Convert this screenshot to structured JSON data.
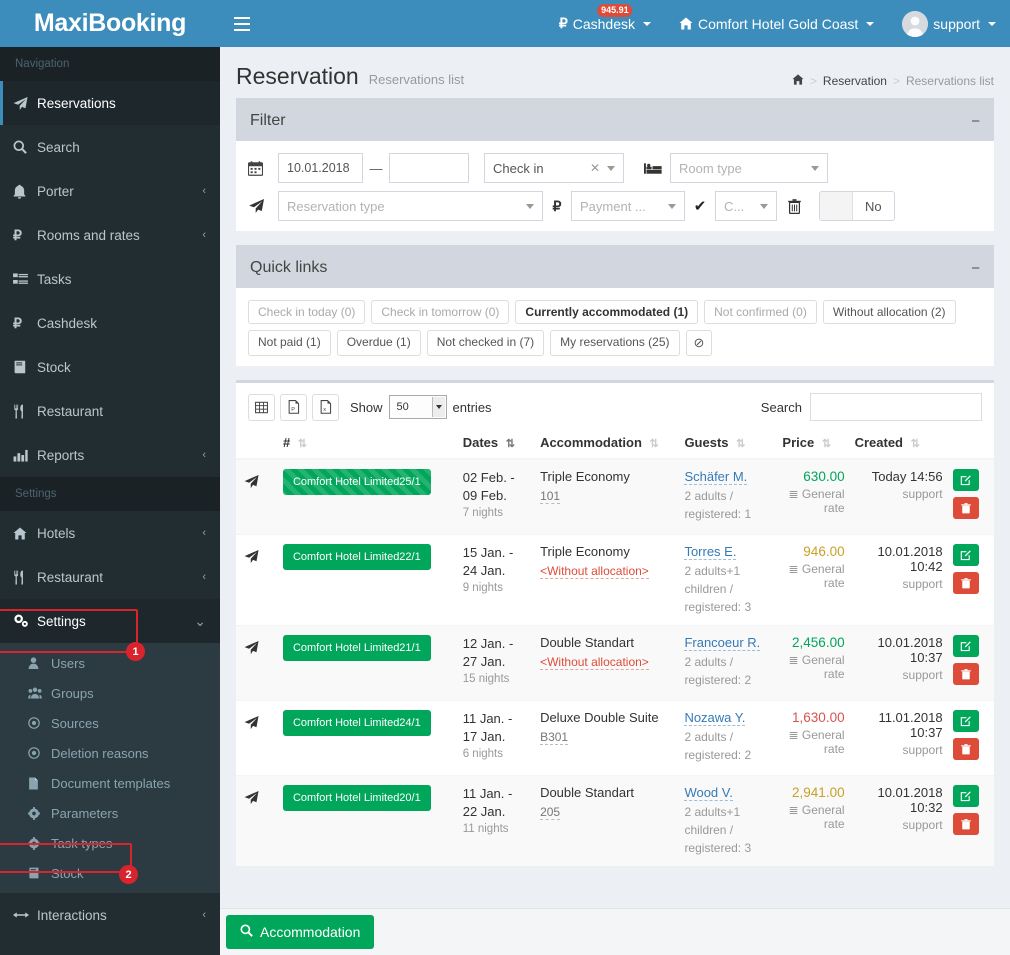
{
  "brand": {
    "name": "MaxiBooking"
  },
  "navbar": {
    "menu_icon": "hamburger-icon",
    "cashdesk": {
      "label": "Cashdesk",
      "badge": "945.91",
      "icon": "ruble-icon"
    },
    "hotel": {
      "label": "Comfort Hotel Gold Coast",
      "icon": "home-icon"
    },
    "user": {
      "label": "support",
      "icon": "avatar-icon"
    }
  },
  "sidebar": {
    "nav_header": "Navigation",
    "settings_header": "Settings",
    "items": [
      {
        "label": "Reservations",
        "icon": "paper-plane-icon",
        "active": true,
        "arrow": ""
      },
      {
        "label": "Search",
        "icon": "search-icon",
        "arrow": ""
      },
      {
        "label": "Porter",
        "icon": "bell-icon",
        "arrow": "‹"
      },
      {
        "label": "Rooms and rates",
        "icon": "ruble-icon",
        "arrow": "‹"
      },
      {
        "label": "Tasks",
        "icon": "tasks-icon",
        "arrow": ""
      },
      {
        "label": "Cashdesk",
        "icon": "ruble-icon",
        "arrow": ""
      },
      {
        "label": "Stock",
        "icon": "book-icon",
        "arrow": ""
      },
      {
        "label": "Restaurant",
        "icon": "cutlery-icon",
        "arrow": ""
      },
      {
        "label": "Reports",
        "icon": "bar-chart-icon",
        "arrow": "‹"
      }
    ],
    "settings_items": [
      {
        "label": "Hotels",
        "icon": "home-icon",
        "arrow": "‹"
      },
      {
        "label": "Restaurant",
        "icon": "cutlery-icon",
        "arrow": "‹"
      },
      {
        "label": "Settings",
        "icon": "gears-icon",
        "arrow": "⌄",
        "highlight": true
      }
    ],
    "settings_sub": [
      {
        "label": "Users",
        "icon": "user-icon"
      },
      {
        "label": "Groups",
        "icon": "users-icon"
      },
      {
        "label": "Sources",
        "icon": "circle-dot-icon"
      },
      {
        "label": "Deletion reasons",
        "icon": "circle-dot-icon"
      },
      {
        "label": "Document templates",
        "icon": "file-icon"
      },
      {
        "label": "Parameters",
        "icon": "gear-icon",
        "highlight": true
      },
      {
        "label": "Task types",
        "icon": "gear-icon"
      },
      {
        "label": "Stock",
        "icon": "book-icon"
      }
    ],
    "interactions": {
      "label": "Interactions",
      "icon": "arrows-h-icon",
      "arrow": "‹"
    },
    "annotations": [
      {
        "num": "1"
      },
      {
        "num": "2"
      }
    ]
  },
  "page": {
    "title": "Reservation",
    "subtitle": "Reservations list",
    "breadcrumb": {
      "home_icon": "home-icon",
      "items": [
        "Reservation",
        "Reservations list"
      ]
    }
  },
  "filter": {
    "title": "Filter",
    "collapse_icon": "−",
    "date_icon": "calendar-icon",
    "date_from": "10.01.2018",
    "date_to": "",
    "dash": "—",
    "date_type": "Check in",
    "bed_icon": "bed-icon",
    "room_type_placeholder": "Room type",
    "plane_icon": "paper-plane-icon",
    "reservation_type_placeholder": "Reservation type",
    "ruble_icon": "ruble-icon",
    "payment_placeholder": "Payment ...",
    "check_icon": "check-icon",
    "confirm_placeholder": "C...",
    "trash_icon": "trash-icon",
    "toggle_label": "No"
  },
  "quick_links": {
    "title": "Quick links",
    "collapse_icon": "−",
    "links": [
      {
        "label": "Check in today (0)",
        "style": "muted"
      },
      {
        "label": "Check in tomorrow (0)",
        "style": "muted"
      },
      {
        "label": "Currently accommodated (1)",
        "style": "strong"
      },
      {
        "label": "Not confirmed (0)",
        "style": "muted"
      },
      {
        "label": "Without allocation (2)",
        "style": "norm"
      },
      {
        "label": "Not paid (1)",
        "style": "norm"
      },
      {
        "label": "Overdue (1)",
        "style": "norm"
      },
      {
        "label": "Not checked in (7)",
        "style": "norm"
      },
      {
        "label": "My reservations (25)",
        "style": "norm"
      }
    ],
    "clear_icon": "⊘"
  },
  "table_toolbar": {
    "buttons": [
      {
        "icon": "table-icon",
        "name": "copy-columns-button"
      },
      {
        "icon": "pdf-icon",
        "name": "export-pdf-button"
      },
      {
        "icon": "excel-icon",
        "name": "export-excel-button"
      }
    ],
    "show_label": "Show",
    "entries_value": "50",
    "entries_label": "entries",
    "search_label": "Search",
    "search_value": ""
  },
  "table": {
    "columns": [
      {
        "label": "#",
        "sort": "both"
      },
      {
        "label": "Dates",
        "sort": "desc"
      },
      {
        "label": "Accommodation",
        "sort": "both"
      },
      {
        "label": "Guests",
        "sort": "both"
      },
      {
        "label": "Price",
        "sort": "both"
      },
      {
        "label": "Created",
        "sort": "both"
      }
    ],
    "rows": [
      {
        "send_icon": "paper-plane-icon",
        "tag": "Comfort Hotel Limited25/1",
        "tag_striped": true,
        "dates": "02 Feb. - 09 Feb.",
        "nights": "7 nights",
        "accommodation": "Triple Economy",
        "room": "101",
        "room_none": false,
        "guest": "Schäfer M.",
        "guest_info": "2 adults / registered: 1",
        "price": "630.00",
        "price_color": "#00a65a",
        "rate": "General rate",
        "created": "Today 14:56",
        "created_by": "support"
      },
      {
        "send_icon": "paper-plane-icon",
        "tag": "Comfort Hotel Limited22/1",
        "tag_striped": false,
        "dates": "15 Jan. - 24 Jan.",
        "nights": "9 nights",
        "accommodation": "Triple Economy",
        "room": "<Without allocation>",
        "room_none": true,
        "guest": "Torres E.",
        "guest_info": "2 adults+1 children / registered: 3",
        "price": "946.00",
        "price_color": "#c8a12a",
        "rate": "General rate",
        "created": "10.01.2018 10:42",
        "created_by": "support"
      },
      {
        "send_icon": "paper-plane-icon",
        "tag": "Comfort Hotel Limited21/1",
        "tag_striped": false,
        "dates": "12 Jan. - 27 Jan.",
        "nights": "15 nights",
        "accommodation": "Double Standart",
        "room": "<Without allocation>",
        "room_none": true,
        "guest": "Francoeur R.",
        "guest_info": "2 adults / registered: 2",
        "price": "2,456.00",
        "price_color": "#00a65a",
        "rate": "General rate",
        "created": "10.01.2018 10:37",
        "created_by": "support"
      },
      {
        "send_icon": "paper-plane-icon",
        "tag": "Comfort Hotel Limited24/1",
        "tag_striped": false,
        "dates": "11 Jan. - 17 Jan.",
        "nights": "6 nights",
        "accommodation": "Deluxe Double Suite",
        "room": "B301",
        "room_none": false,
        "guest": "Nozawa Y.",
        "guest_info": "2 adults / registered: 2",
        "price": "1,630.00",
        "price_color": "#d9534f",
        "rate": "General rate",
        "created": "11.01.2018 10:37",
        "created_by": "support"
      },
      {
        "send_icon": "paper-plane-icon",
        "tag": "Comfort Hotel Limited20/1",
        "tag_striped": false,
        "dates": "11 Jan. - 22 Jan.",
        "nights": "11 nights",
        "accommodation": "Double Standart",
        "room": "205",
        "room_none": false,
        "guest": "Wood V.",
        "guest_info": "2 adults+1 children / registered: 3",
        "price": "2,941.00",
        "price_color": "#c8a12a",
        "rate": "General rate",
        "created": "10.01.2018 10:32",
        "created_by": "support"
      }
    ],
    "row_actions": {
      "edit_icon": "edit-icon",
      "delete_icon": "trash-icon"
    }
  },
  "footer": {
    "accommodation_button": "Accommodation",
    "search_icon": "search-icon"
  },
  "colors": {
    "primary": "#3c8dbc",
    "sidebar": "#222d32",
    "success": "#00a65a",
    "danger": "#dd4b39",
    "highlight": "#d9232d"
  }
}
